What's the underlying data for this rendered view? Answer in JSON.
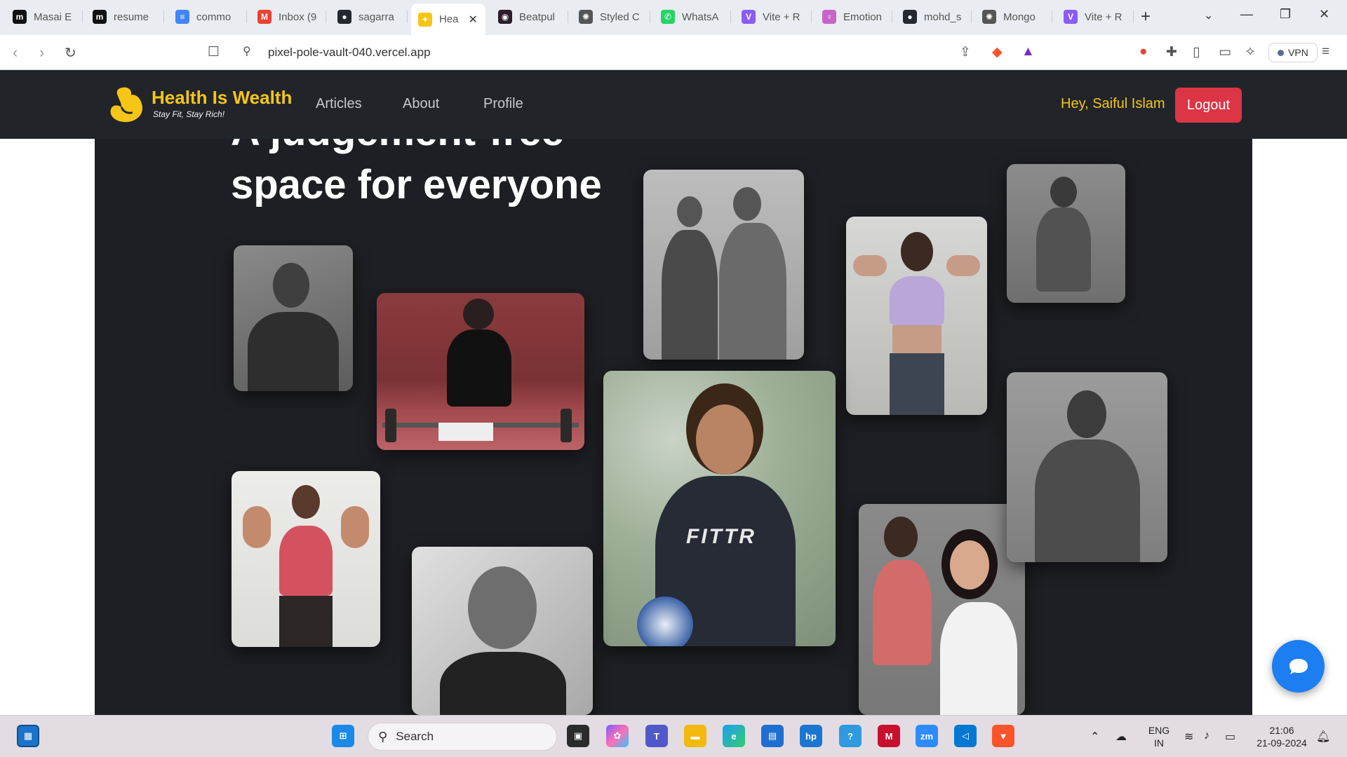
{
  "browser": {
    "tabs": [
      {
        "title": "Masai E",
        "icon": "masai-icon",
        "color": "#111111",
        "glyph": "m"
      },
      {
        "title": "resume",
        "icon": "masai-icon",
        "color": "#111111",
        "glyph": "m"
      },
      {
        "title": "commo",
        "icon": "google-docs-icon",
        "color": "#4285f4",
        "glyph": "≡"
      },
      {
        "title": "Inbox (9",
        "icon": "gmail-icon",
        "color": "#ea4335",
        "glyph": "M"
      },
      {
        "title": "sagarra",
        "icon": "github-icon",
        "color": "#24292f",
        "glyph": "●"
      },
      {
        "title": "Hea",
        "icon": "health-logo-icon",
        "color": "#f5c518",
        "glyph": "✦",
        "active": true
      },
      {
        "title": "Beatpul",
        "icon": "beatpulse-icon",
        "color": "#2d1b2e",
        "glyph": "◉"
      },
      {
        "title": "Styled C",
        "icon": "openai-icon",
        "color": "#555555",
        "glyph": "✺"
      },
      {
        "title": "WhatsA",
        "icon": "whatsapp-icon",
        "color": "#25d366",
        "glyph": "✆"
      },
      {
        "title": "Vite + R",
        "icon": "vite-icon",
        "color": "#8a5cf6",
        "glyph": "V"
      },
      {
        "title": "Emotion",
        "icon": "emotion-icon",
        "color": "#c864c8",
        "glyph": "♀"
      },
      {
        "title": "mohd_s",
        "icon": "github-icon",
        "color": "#24292f",
        "glyph": "●"
      },
      {
        "title": "Mongo",
        "icon": "openai-icon",
        "color": "#555555",
        "glyph": "✺"
      },
      {
        "title": "Vite + R",
        "icon": "vite-icon",
        "color": "#8a5cf6",
        "glyph": "V"
      }
    ],
    "url": "pixel-pole-vault-040.vercel.app",
    "vpn_label": "VPN"
  },
  "site": {
    "brand": "Health Is Wealth",
    "tagline": "Stay Fit, Stay Rich!",
    "nav": [
      "Articles",
      "About",
      "Profile"
    ],
    "greeting": "Hey, Saiful Islam",
    "logout": "Logout",
    "headline_line1": "A judgement-free",
    "headline_line2": "space for everyone",
    "shirt_text": "FITTR",
    "colors": {
      "navbar": "#212529",
      "hero_bg": "#1e1f24",
      "brand": "#f5c518",
      "logout": "#dc3545",
      "chat": "#1d7ef2"
    }
  },
  "taskbar": {
    "search_label": "Search",
    "lang_line1": "ENG",
    "lang_line2": "IN",
    "time": "21:06",
    "date": "21-09-2024"
  }
}
